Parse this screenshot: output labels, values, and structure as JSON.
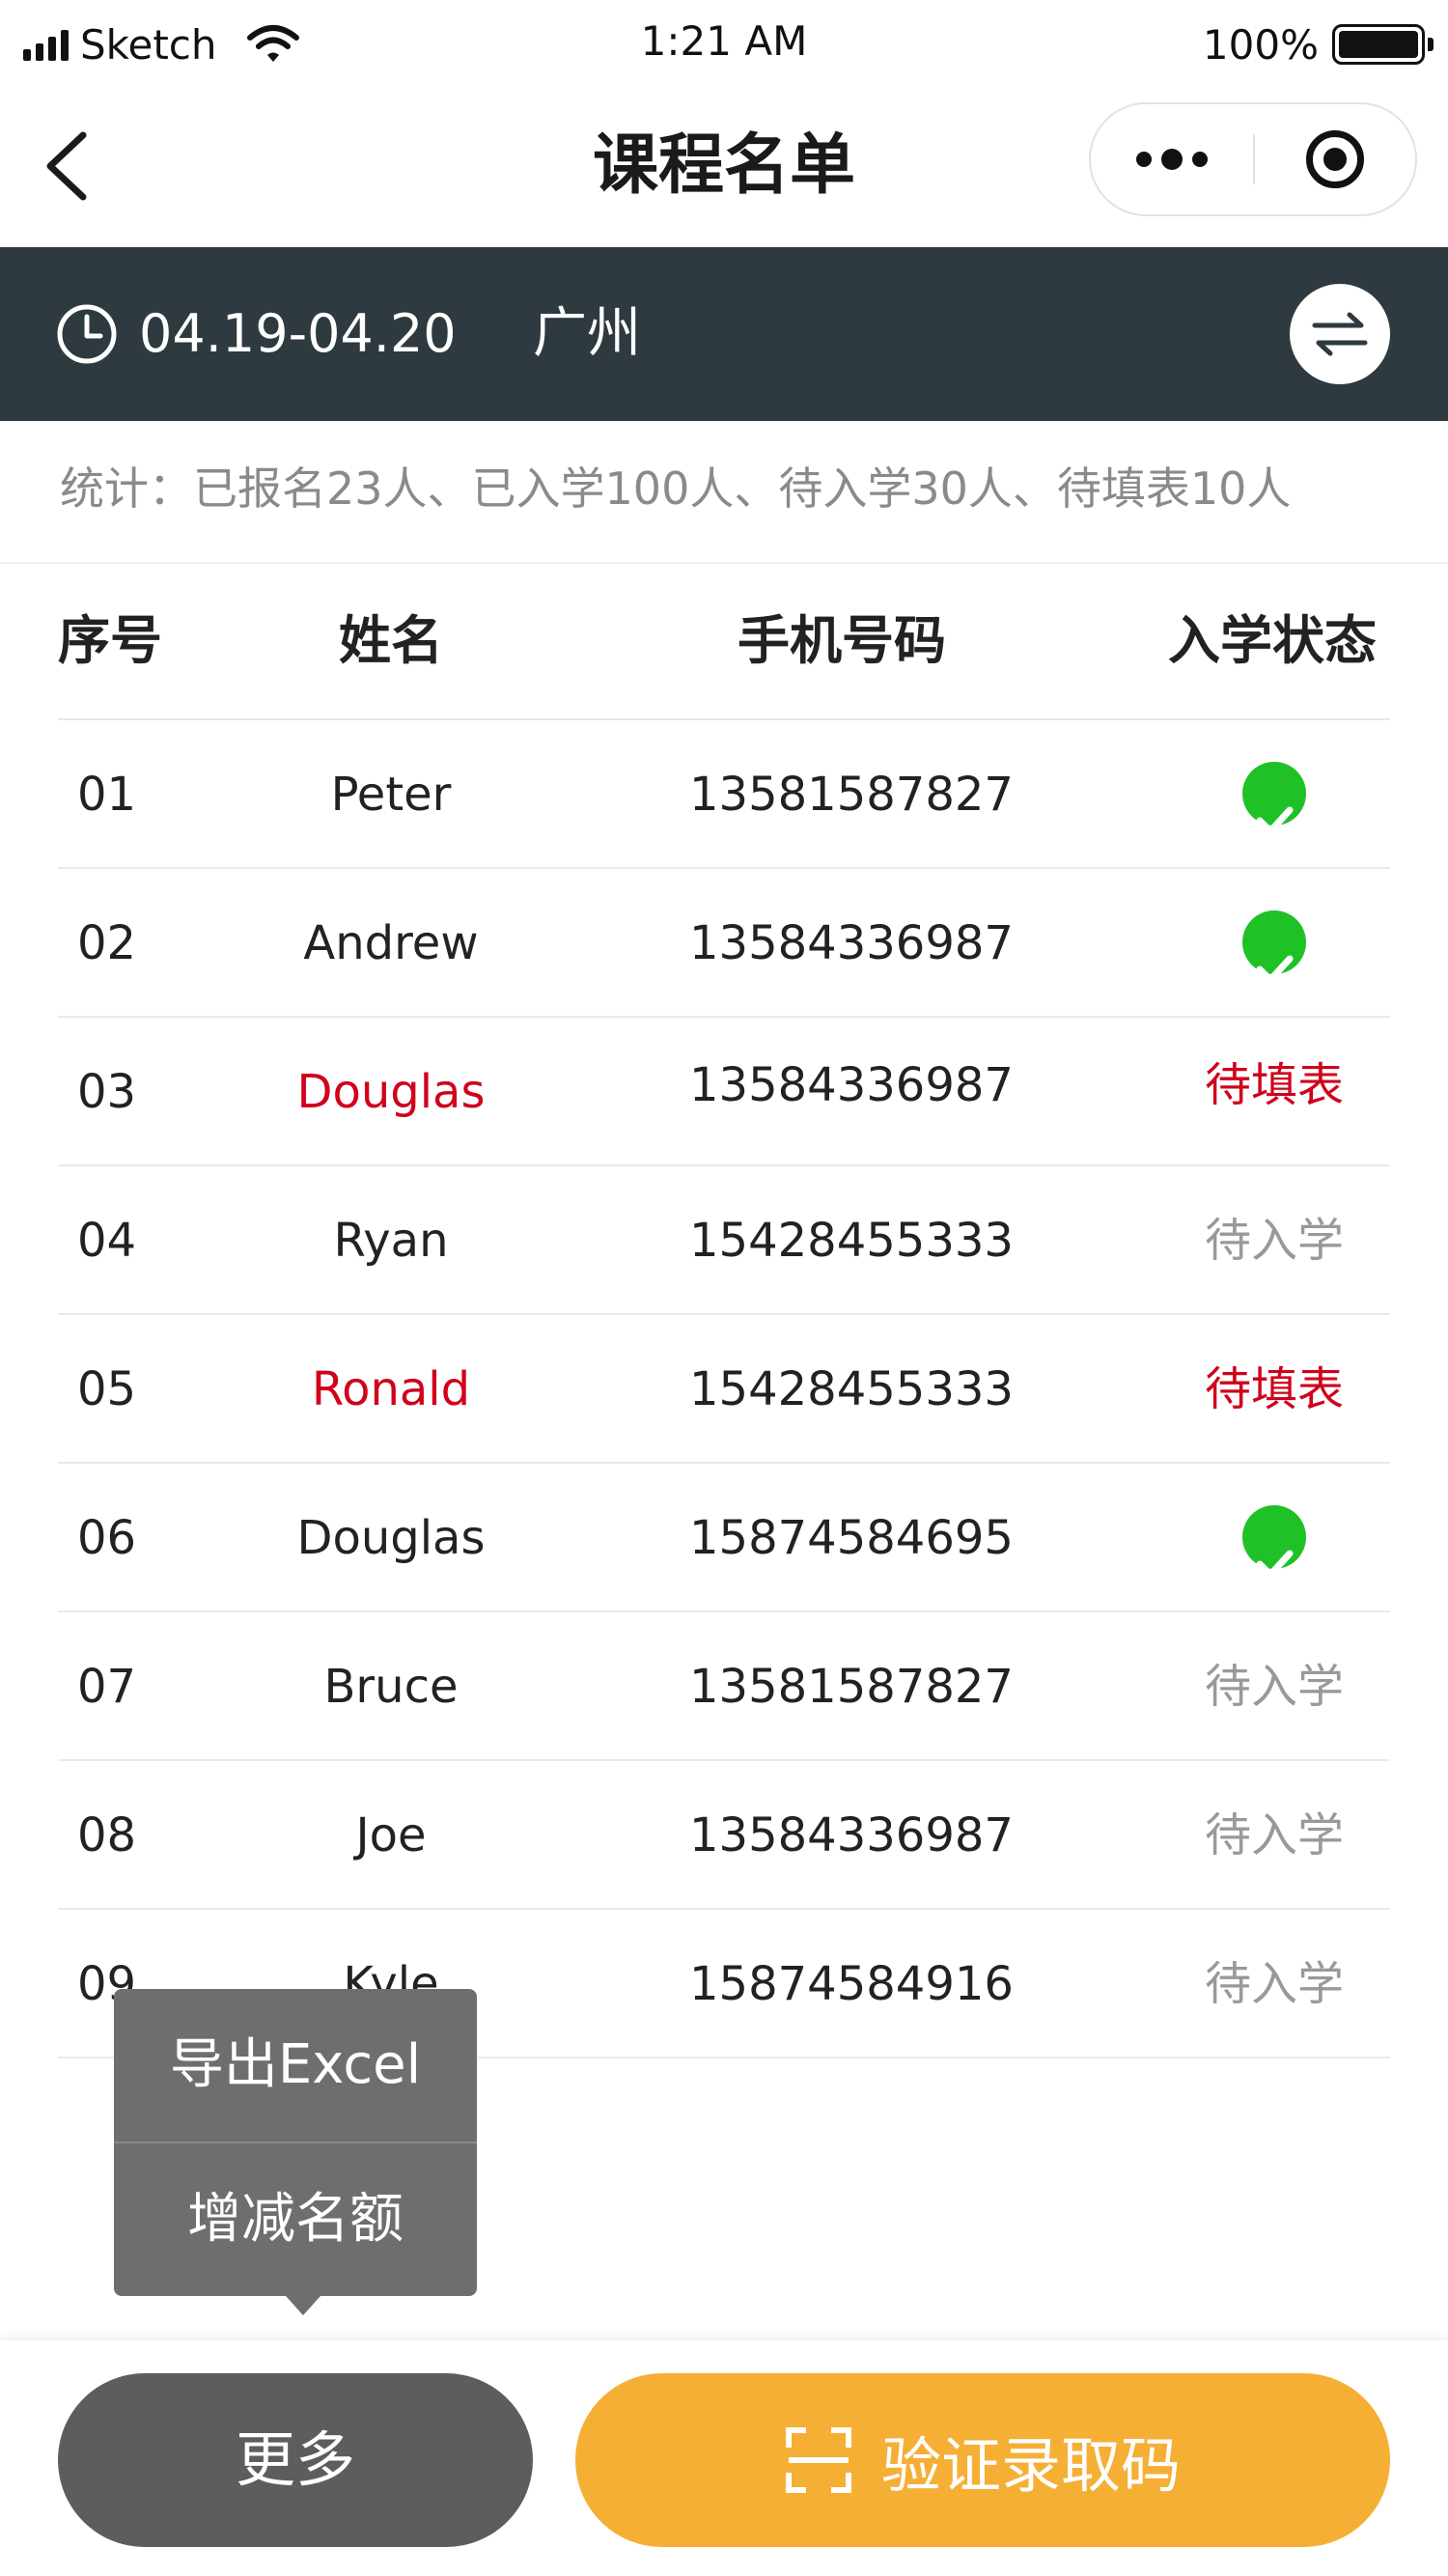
{
  "status_bar": {
    "carrier": "Sketch",
    "time": "1:21 AM",
    "battery": "100%"
  },
  "nav": {
    "title": "课程名单",
    "back_icon": "chevron-left-icon",
    "more_icon": "more-dots-icon",
    "close_icon": "target-close-icon"
  },
  "info": {
    "date_range": "04.19-04.20",
    "city": "广州",
    "clock_icon": "clock-icon",
    "switch_icon": "swap-arrows-icon"
  },
  "stats": "统计：已报名23人、已入学100人、待入学30人、待填表10人",
  "table": {
    "headers": [
      "序号",
      "姓名",
      "手机号码",
      "入学状态"
    ],
    "rows": [
      {
        "no": "01",
        "name": "Peter",
        "phone": "13581587827",
        "status": "",
        "status_type": "check",
        "name_color": "normal"
      },
      {
        "no": "02",
        "name": "Andrew",
        "phone": "13584336987",
        "status": "",
        "status_type": "check",
        "name_color": "normal"
      },
      {
        "no": "03",
        "name": "Douglas",
        "phone": "13584336987",
        "status": "待填表",
        "status_type": "pending-form",
        "name_color": "red"
      },
      {
        "no": "04",
        "name": "Ryan",
        "phone": "15428455333",
        "status": "待入学",
        "status_type": "pending-enroll",
        "name_color": "normal"
      },
      {
        "no": "05",
        "name": "Ronald",
        "phone": "15428455333",
        "status": "待填表",
        "status_type": "pending-form",
        "name_color": "red"
      },
      {
        "no": "06",
        "name": "Douglas",
        "phone": "15874584695",
        "status": "",
        "status_type": "check",
        "name_color": "normal"
      },
      {
        "no": "07",
        "name": "Bruce",
        "phone": "13581587827",
        "status": "待入学",
        "status_type": "pending-enroll",
        "name_color": "normal"
      },
      {
        "no": "08",
        "name": "Joe",
        "phone": "13584336987",
        "status": "待入学",
        "status_type": "pending-enroll",
        "name_color": "normal"
      },
      {
        "no": "09",
        "name": "Kyle",
        "phone": "15874584916",
        "status": "待入学",
        "status_type": "pending-enroll",
        "name_color": "normal"
      }
    ]
  },
  "popup": {
    "items": [
      "导出Excel",
      "增减名额"
    ]
  },
  "bottom": {
    "more_label": "更多",
    "verify_label": "验证录取码",
    "scan_icon": "scan-icon"
  },
  "colors": {
    "header_bg": "#2e3a3f",
    "accent_orange": "#f5af35",
    "more_btn": "#5d5d5d",
    "check_green": "#1fc127",
    "alert_red": "#d0021b",
    "muted": "#999999"
  }
}
